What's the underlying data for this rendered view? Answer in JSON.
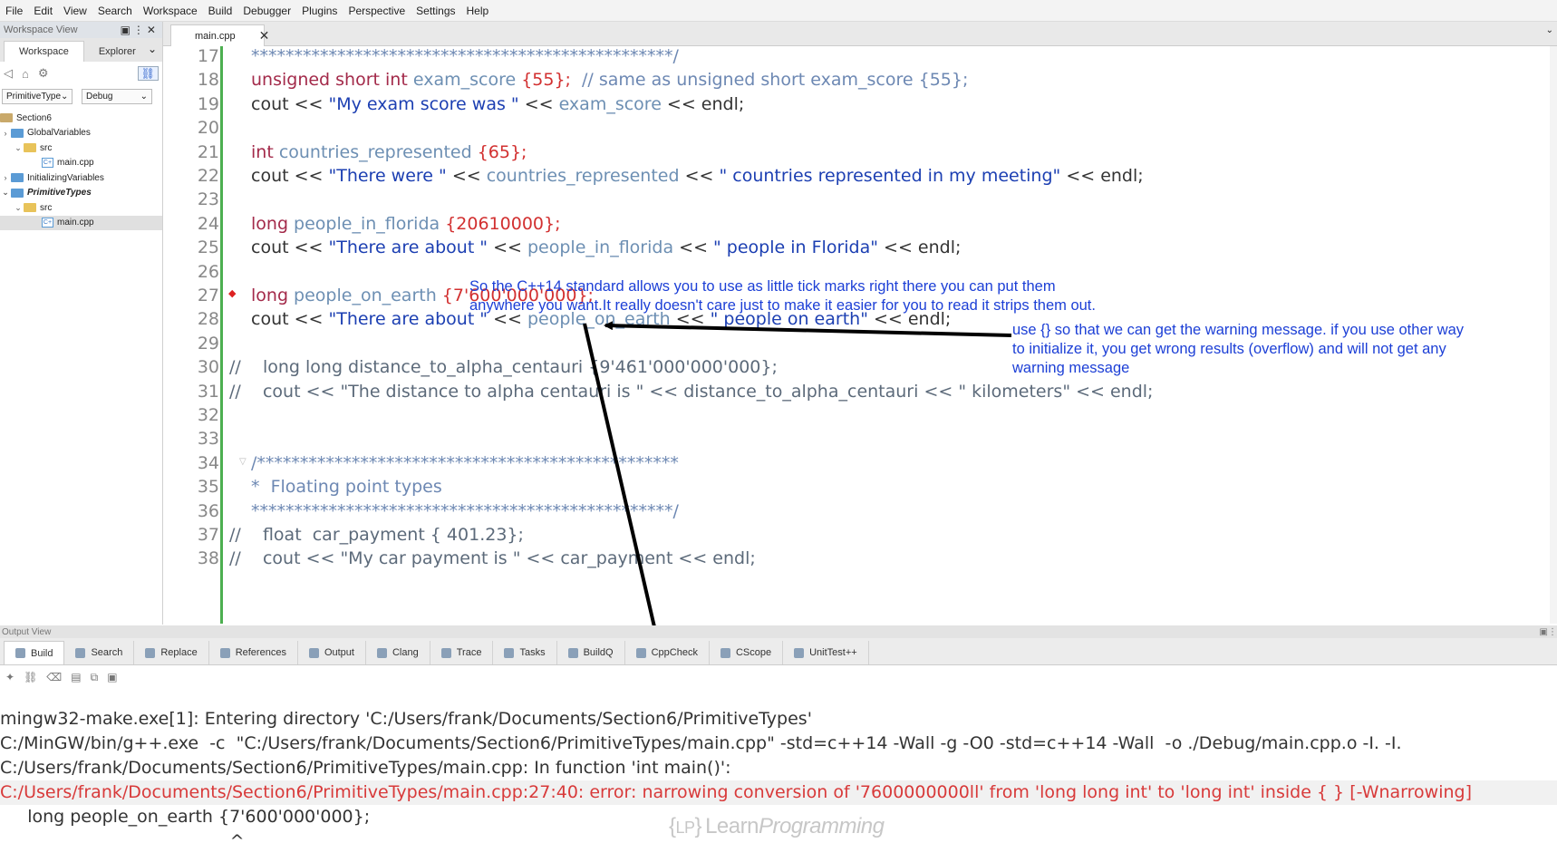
{
  "menu": [
    "File",
    "Edit",
    "View",
    "Search",
    "Workspace",
    "Build",
    "Debugger",
    "Plugins",
    "Perspective",
    "Settings",
    "Help"
  ],
  "workspace": {
    "title": "Workspace View",
    "tabs": [
      "Workspace",
      "Explorer"
    ],
    "project_select": "PrimitiveType",
    "config_select": "Debug",
    "tree": [
      "Section6",
      "GlobalVariables",
      "src",
      "main.cpp",
      "InitializingVariables",
      "PrimitiveTypes",
      "src",
      "main.cpp"
    ]
  },
  "editor": {
    "tab_label": "main.cpp",
    "lines": [
      {
        "n": "17",
        "text": "*************************************************/"
      },
      {
        "n": "18",
        "kw": "unsigned short int ",
        "id": "exam_score ",
        "num": "{55};",
        "cmt": "  // same as unsigned short exam_score {55};"
      },
      {
        "n": "19",
        "a": "cout << ",
        "str": "\"My exam score was \"",
        "b": " << ",
        "id": "exam_score",
        "c": " << endl;"
      },
      {
        "n": "20"
      },
      {
        "n": "21",
        "kw": "int ",
        "id": "countries_represented ",
        "num": "{65};"
      },
      {
        "n": "22",
        "a": "cout << ",
        "str": "\"There were \"",
        "b": " << ",
        "id": "countries_represented",
        "c": " << ",
        "str2": "\" countries represented in my meeting\"",
        "d": " << endl;"
      },
      {
        "n": "23"
      },
      {
        "n": "24",
        "kw": "long ",
        "id": "people_in_florida ",
        "num": "{20610000};"
      },
      {
        "n": "25",
        "a": "cout << ",
        "str": "\"There are about \"",
        "b": " << ",
        "id": "people_in_florida",
        "c": " << ",
        "str2": "\" people in Florida\"",
        "d": " << endl;"
      },
      {
        "n": "26"
      },
      {
        "n": "27",
        "kw": "long ",
        "id": "people_on_earth ",
        "num": "{7'600'000'000};"
      },
      {
        "n": "28",
        "a": "cout << ",
        "str": "\"There are about \"",
        "b": " << ",
        "id": "people_on_earth",
        "c": " << ",
        "str2": "\" people on earth\"",
        "d": " << endl;"
      },
      {
        "n": "29"
      },
      {
        "n": "30",
        "comment": "//    long long distance_to_alpha_centauri {9'461'000'000'000};"
      },
      {
        "n": "31",
        "comment": "//    cout << \"The distance to alpha centauri is \" << distance_to_alpha_centauri << \" kilometers\" << endl;"
      },
      {
        "n": "32"
      },
      {
        "n": "33"
      },
      {
        "n": "34",
        "text": "/*************************************************"
      },
      {
        "n": "35",
        "text": "*  Floating point types"
      },
      {
        "n": "36",
        "text": "*************************************************/"
      },
      {
        "n": "37",
        "comment": "//    float  car_payment { 401.23};"
      },
      {
        "n": "38",
        "comment": "//    cout << \"My car payment is \" << car_payment << endl;"
      }
    ]
  },
  "annotations": {
    "note1": [
      "So the C++14 standard allows you to use as little tick marks right there you can put them",
      "anywhere you want.It really doesn't care just to make it easier for you to read it strips them out."
    ],
    "note2": [
      "use {} so that we can get the warning message. if you use other way",
      "to initialize it, you get wrong results (overflow) and will not get any",
      "warning message"
    ]
  },
  "output": {
    "title": "Output View",
    "tabs": [
      "Build",
      "Search",
      "Replace",
      "References",
      "Output",
      "Clang",
      "Trace",
      "Tasks",
      "BuildQ",
      "CppCheck",
      "CScope",
      "UnitTest++"
    ],
    "lines": [
      "mingw32-make.exe[1]: Entering directory 'C:/Users/frank/Documents/Section6/PrimitiveTypes'",
      "C:/MinGW/bin/g++.exe  -c  \"C:/Users/frank/Documents/Section6/PrimitiveTypes/main.cpp\" -std=c++14 -Wall -g -O0 -std=c++14 -Wall  -o ./Debug/main.cpp.o -I. -I.",
      "C:/Users/frank/Documents/Section6/PrimitiveTypes/main.cpp: In function 'int main()':",
      "C:/Users/frank/Documents/Section6/PrimitiveTypes/main.cpp:27:40: error: narrowing conversion of '7600000000ll' from 'long long int' to 'long int' inside { } [-Wnarrowing]",
      "     long people_on_earth {7'600'000'000};",
      "                                          ^"
    ],
    "watermark": "{LP} LearnProgramming"
  },
  "colors": {
    "annotation": "#1c3fd6",
    "error": "#d83a3a",
    "keyword": "#a32a4a",
    "string": "#1c3fb2",
    "number": "#d23030"
  }
}
